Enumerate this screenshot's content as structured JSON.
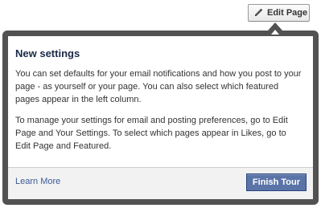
{
  "toolbar": {
    "edit_page_label": "Edit Page",
    "edit_page_icon": "pencil-icon"
  },
  "tour": {
    "title": "New settings",
    "paragraphs": [
      "You can set defaults for your email notifications and how you post to your page - as yourself or your page. You can also select which featured pages appear in the left column.",
      "To manage your settings for email and posting preferences, go to Edit Page and Your Settings. To select which pages appear in Likes, go to Edit Page and Featured."
    ],
    "learn_more_label": "Learn More",
    "finish_label": "Finish Tour"
  },
  "colors": {
    "dialog_frame": "#525252",
    "link": "#3b5998",
    "primary_button": "#5b74a8",
    "footer_bg": "#f2f2f2"
  }
}
